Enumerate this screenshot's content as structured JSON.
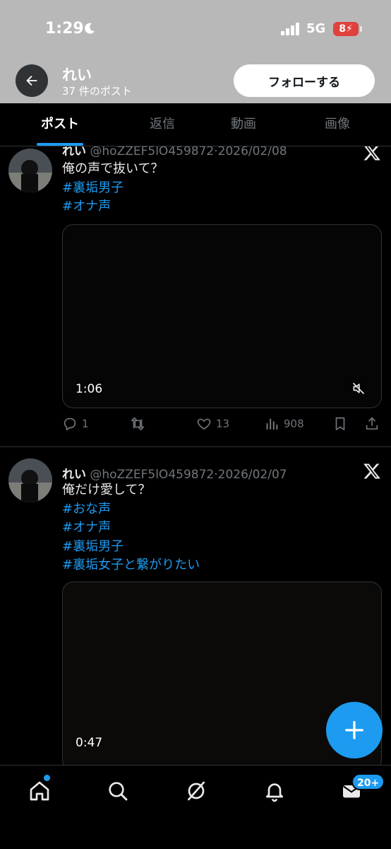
{
  "status_bar": {
    "time": "1:29",
    "network": "5G",
    "battery": "8"
  },
  "header": {
    "profile_name": "れい",
    "post_count": "37 件のポスト",
    "follow_label": "フォローする"
  },
  "tabs": [
    {
      "label": "ポスト",
      "active": true
    },
    {
      "label": "返信",
      "active": false
    },
    {
      "label": "動画",
      "active": false
    },
    {
      "label": "画像",
      "active": false
    }
  ],
  "posts": [
    {
      "author": "れい",
      "handle": "@hoZZEF5lO459872",
      "date": "2026/02/08",
      "text": "俺の声で抜いて？",
      "hashtags": [
        "#裏垢男子",
        "#オナ声"
      ],
      "video_duration": "1:06",
      "replies": "1",
      "reposts": "",
      "likes": "13",
      "views": "908"
    },
    {
      "author": "れい",
      "handle": "@hoZZEF5lO459872",
      "date": "2026/02/07",
      "text": "俺だけ愛して？",
      "hashtags": [
        "#おな声",
        "#オナ声",
        "#裏垢男子",
        "#裏垢女子と繋がりたい"
      ],
      "video_duration": "0:47"
    }
  ],
  "bottom_nav": {
    "messages_badge": "20+"
  },
  "colors": {
    "accent": "#1d9bf0",
    "background": "#000000",
    "header_bg": "#b8b8b8",
    "muted_text": "#71767b",
    "battery_low": "#e0413d"
  }
}
